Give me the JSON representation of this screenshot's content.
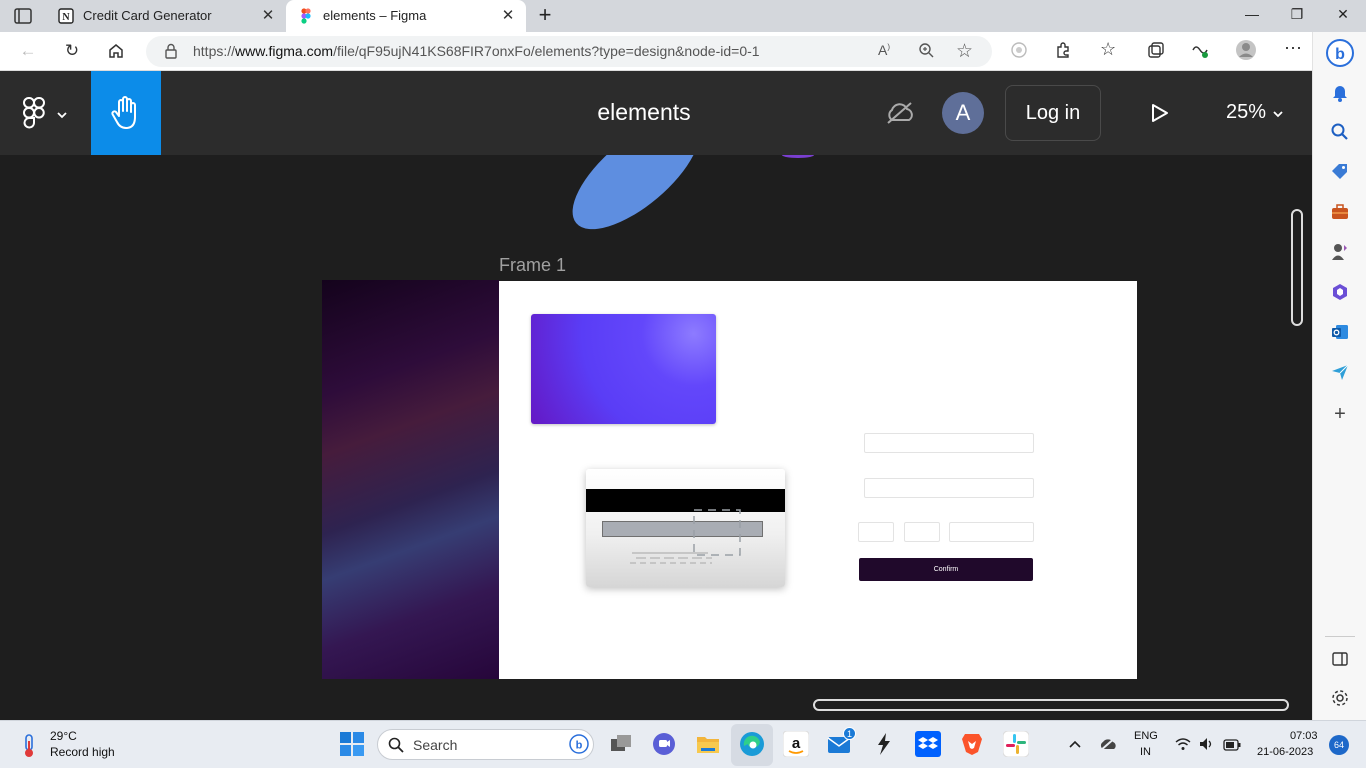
{
  "browser": {
    "tabs": [
      {
        "title": "Credit Card Generator",
        "icon": "notion-icon",
        "active": false
      },
      {
        "title": "elements – Figma",
        "icon": "figma-icon",
        "active": true
      }
    ],
    "url_scheme": "https://",
    "url_domain": "www.figma.com",
    "url_path": "/file/qF95ujN41KS68FIR7onxFo/elements?type=design&node-id=0-1"
  },
  "figma": {
    "file_name": "elements",
    "avatar_initial": "A",
    "login_label": "Log in",
    "zoom_level": "25%",
    "frame_label": "Frame 1",
    "confirm_label": "Confirm",
    "accent_color": "#0c8ce9"
  },
  "taskbar": {
    "temperature": "29°C",
    "weather_desc": "Record high",
    "search_placeholder": "Search",
    "mail_badge": "1",
    "lang_line1": "ENG",
    "lang_line2": "IN",
    "time": "07:03",
    "date": "21-06-2023",
    "notification_count": "64"
  }
}
